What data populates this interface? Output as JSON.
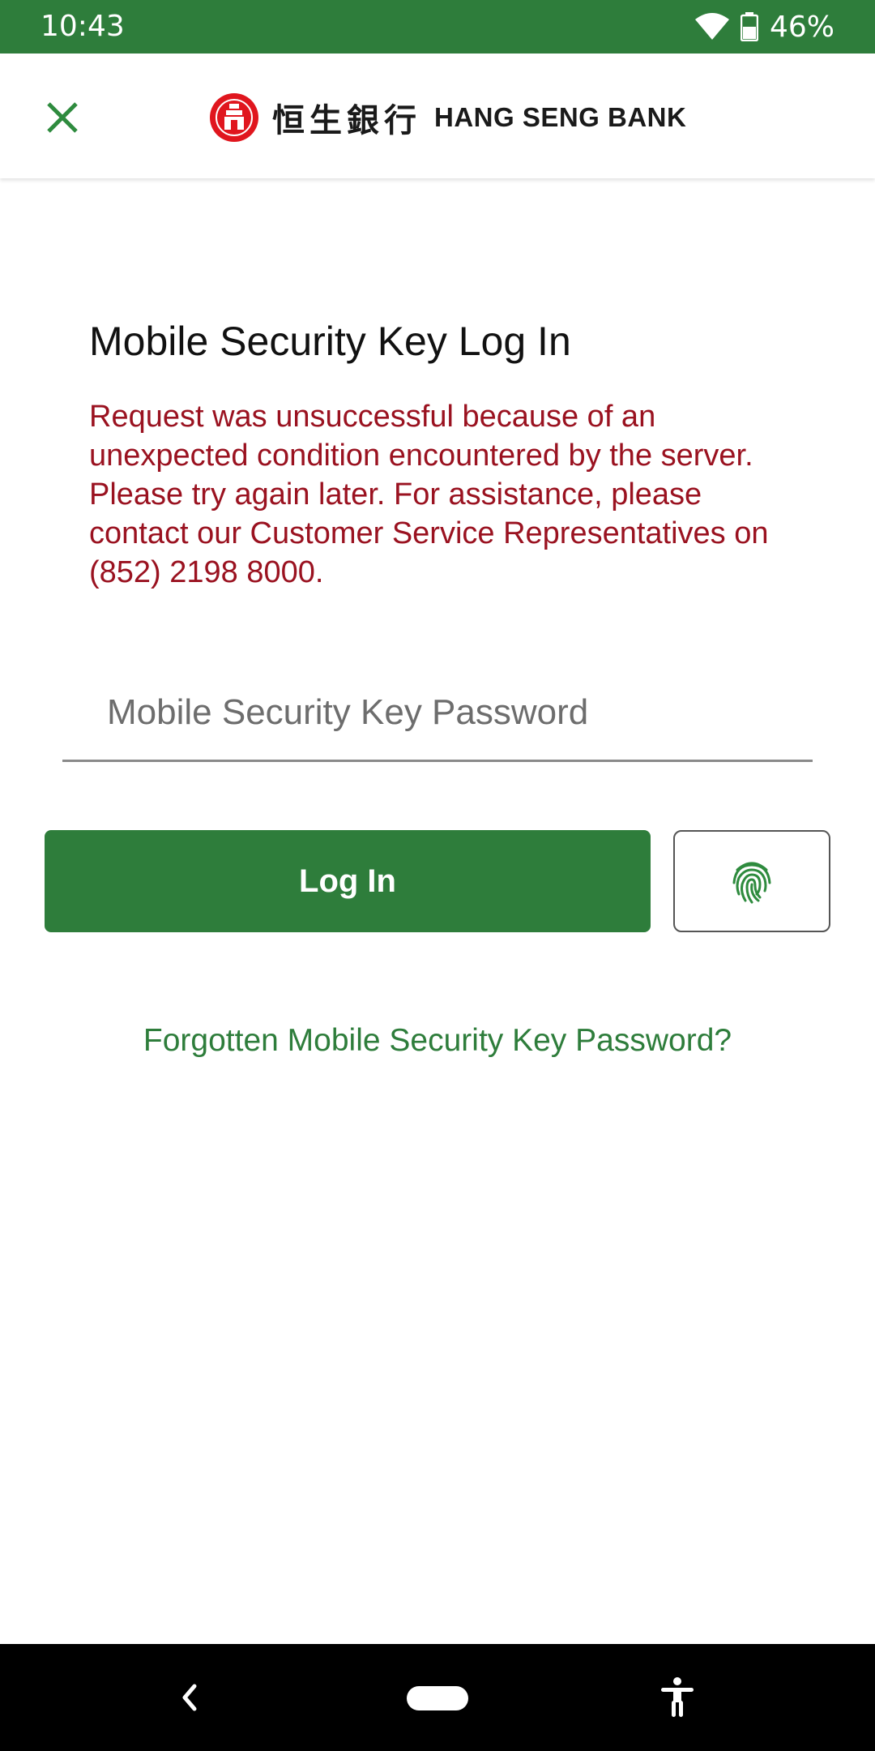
{
  "status_bar": {
    "time": "10:43",
    "battery": "46%"
  },
  "header": {
    "brand_chinese": "恒生銀行",
    "brand_english": "HANG SENG BANK"
  },
  "main": {
    "title": "Mobile Security Key Log In",
    "error": "Request was unsuccessful because of an unexpected condition encountered by the server. Please try again later. For assistance, please contact our Customer Service Representatives on (852) 2198 8000.",
    "password_placeholder": "Mobile Security Key Password",
    "login_label": "Log In",
    "forgot_link": "Forgotten Mobile Security Key Password?"
  },
  "colors": {
    "brand_green": "#2e7d3b",
    "error_red": "#9a1220",
    "logo_red": "#e0161e"
  },
  "icons": [
    "wifi-icon",
    "battery-icon",
    "close-icon",
    "hang-seng-logo-icon",
    "fingerprint-icon",
    "back-icon",
    "home-pill-icon",
    "accessibility-icon"
  ]
}
